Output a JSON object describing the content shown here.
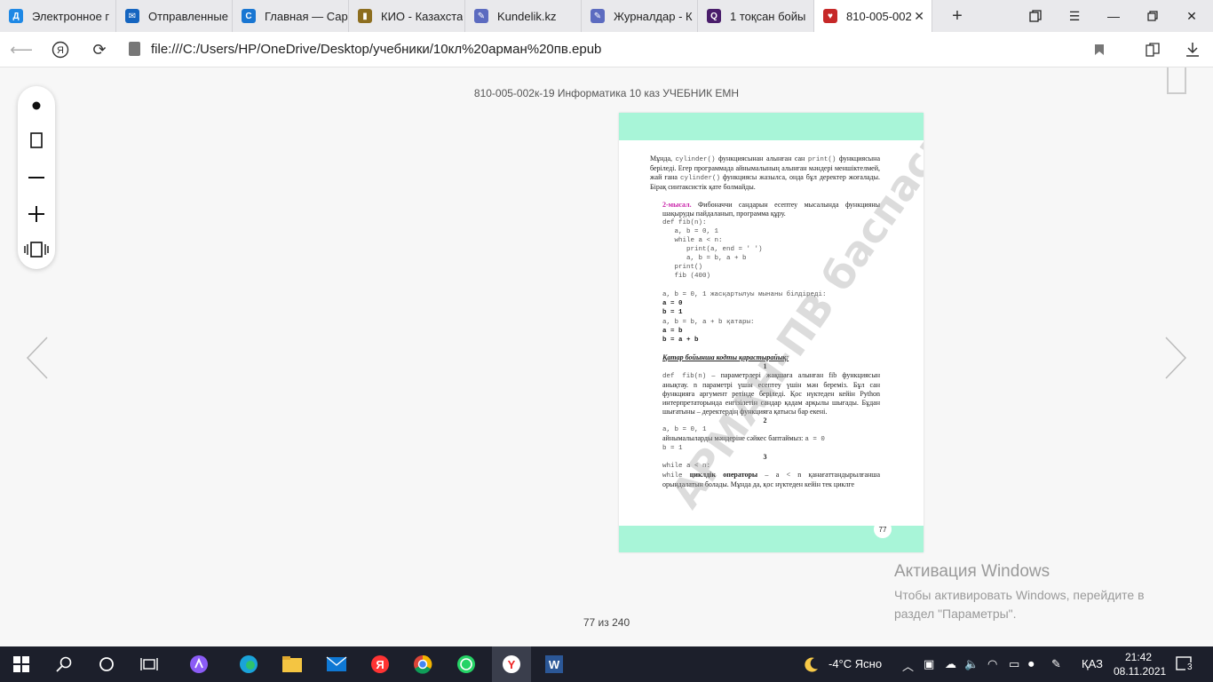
{
  "browser": {
    "tabs": [
      {
        "title": "Электронное г",
        "fav_color": "#1e88e5",
        "fav_glyph": "Д"
      },
      {
        "title": "Отправленные",
        "fav_color": "#1565c0",
        "fav_glyph": "✉"
      },
      {
        "title": "Главная — Сар",
        "fav_color": "#1976d2",
        "fav_glyph": "C"
      },
      {
        "title": "КИО - Казахста",
        "fav_color": "#8d6e1f",
        "fav_glyph": "▮"
      },
      {
        "title": "Kundelik.kz",
        "fav_color": "#5c6bc0",
        "fav_glyph": "✎"
      },
      {
        "title": "Журналдар - К",
        "fav_color": "#5c6bc0",
        "fav_glyph": "✎"
      },
      {
        "title": "1 тоқсан бойы",
        "fav_color": "#4a1d6b",
        "fav_glyph": "Q"
      },
      {
        "title": "810-005-002",
        "fav_color": "#c62828",
        "fav_glyph": "♥"
      }
    ],
    "active_tab": 7,
    "new_tab": "+",
    "url": "file:///C:/Users/HP/OneDrive/Desktop/учебники/10кл%20арман%20пв.epub"
  },
  "reader": {
    "book_title": "810-005-002к-19 Информатика 10 каз УЧЕБНИК ЕМН",
    "page_counter": "77 из 240",
    "page_number": "77",
    "watermark": "АРМАН-ПВ баспасы"
  },
  "page": {
    "p1_a": "Мұнда, ",
    "p1_code1": "cylinder()",
    "p1_b": " функциясынан алынған сан ",
    "p1_code2": "print()",
    "p1_c": " функциясына беріледі. Егер программада айнымалының алынған мәндері меншіктелмей, жай ғана ",
    "p1_code3": "cylinder()",
    "p1_d": " функциясы жазылса, онда бұл деректер жоғалады. Бірақ синтаксистік қате болмайды.",
    "ex_label": "2-мысал.",
    "ex_text": " Фибоначчи сандарын есептеу мысалында функцияны шақыруды пайдаланып, программа құру.",
    "code_block": "def fib(n):\n   a, b = 0, 1\n   while a < n:\n      print(a, end = ' ')\n      a, b = b, a + b\n   print()\n   fib (400)",
    "line_a": "a, b = 0, 1",
    "line_a_text": " жасқартылуы мынаны білдіреді:",
    "a0": "a = 0",
    "b1": "b  = 1",
    "line_b": "a, b = b, a + b",
    "line_b_text": " қатары:",
    "ab": "a = b",
    "bab": "b = a + b",
    "heading": "Қатар бойынша кодты қарастырайық:",
    "n1": "1",
    "s1_code": "def  fib(n)",
    "s1_text": " – параметрлері жақшаға алынған fib функциясын анықтау. n параметрі үшін есептеу үшін мән береміз. Бұл сан функцияға аргумент ретінде беріледі. Қос нүктеден кейін Python интерпретаторында енгізілетін сандар қадам арқылы шығады. Бұдан шығатыны – деректердің функцияға қатысы бар екені.",
    "n2": "2",
    "s2_code": "a, b = 0, 1",
    "s2_text": "айнымалыларды мәндеріне сәйкес баптаймыз: ",
    "s2_code2": "a = 0",
    "s2_code3": "b = 1",
    "n3": "3",
    "s3_code": "while a < n:",
    "s3_code2": "while",
    "s3_bold": " циклдік операторы",
    "s3_text": " – a < n қанағаттандырылғанша орындалатын болады. Мұнда да, қос нүктеден кейін тек циклге"
  },
  "activation": {
    "title": "Активация Windows",
    "text": "Чтобы активировать Windows, перейдите в раздел \"Параметры\"."
  },
  "taskbar": {
    "weather": "-4°C  Ясно",
    "lang": "ҚАЗ",
    "time": "21:42",
    "date": "08.11.2021",
    "notifications": "3"
  }
}
